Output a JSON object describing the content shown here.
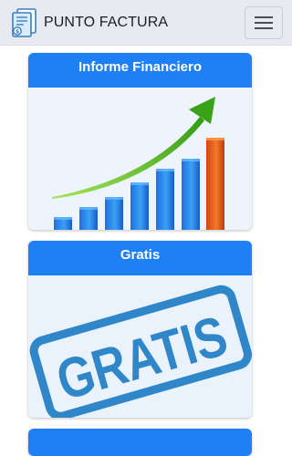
{
  "navbar": {
    "brand_text": "PUNTO FACTURA",
    "logo_icon": "invoice-document-icon",
    "menu_icon": "hamburger-menu-icon"
  },
  "cards": [
    {
      "title": "Informe Financiero",
      "image_icon": "growth-bar-chart-with-arrow-icon"
    },
    {
      "title": "Gratis",
      "image_icon": "gratis-stamp-icon",
      "stamp_text": "GRATIS"
    },
    {
      "title": ""
    }
  ],
  "colors": {
    "card_header": "#1f80f5",
    "navbar_bg": "#e7ebf1",
    "bar_blue": "#2a8ef0",
    "bar_orange": "#e8561a",
    "arrow_green": "#5bbf1a",
    "stamp_blue": "#2f86c8"
  }
}
